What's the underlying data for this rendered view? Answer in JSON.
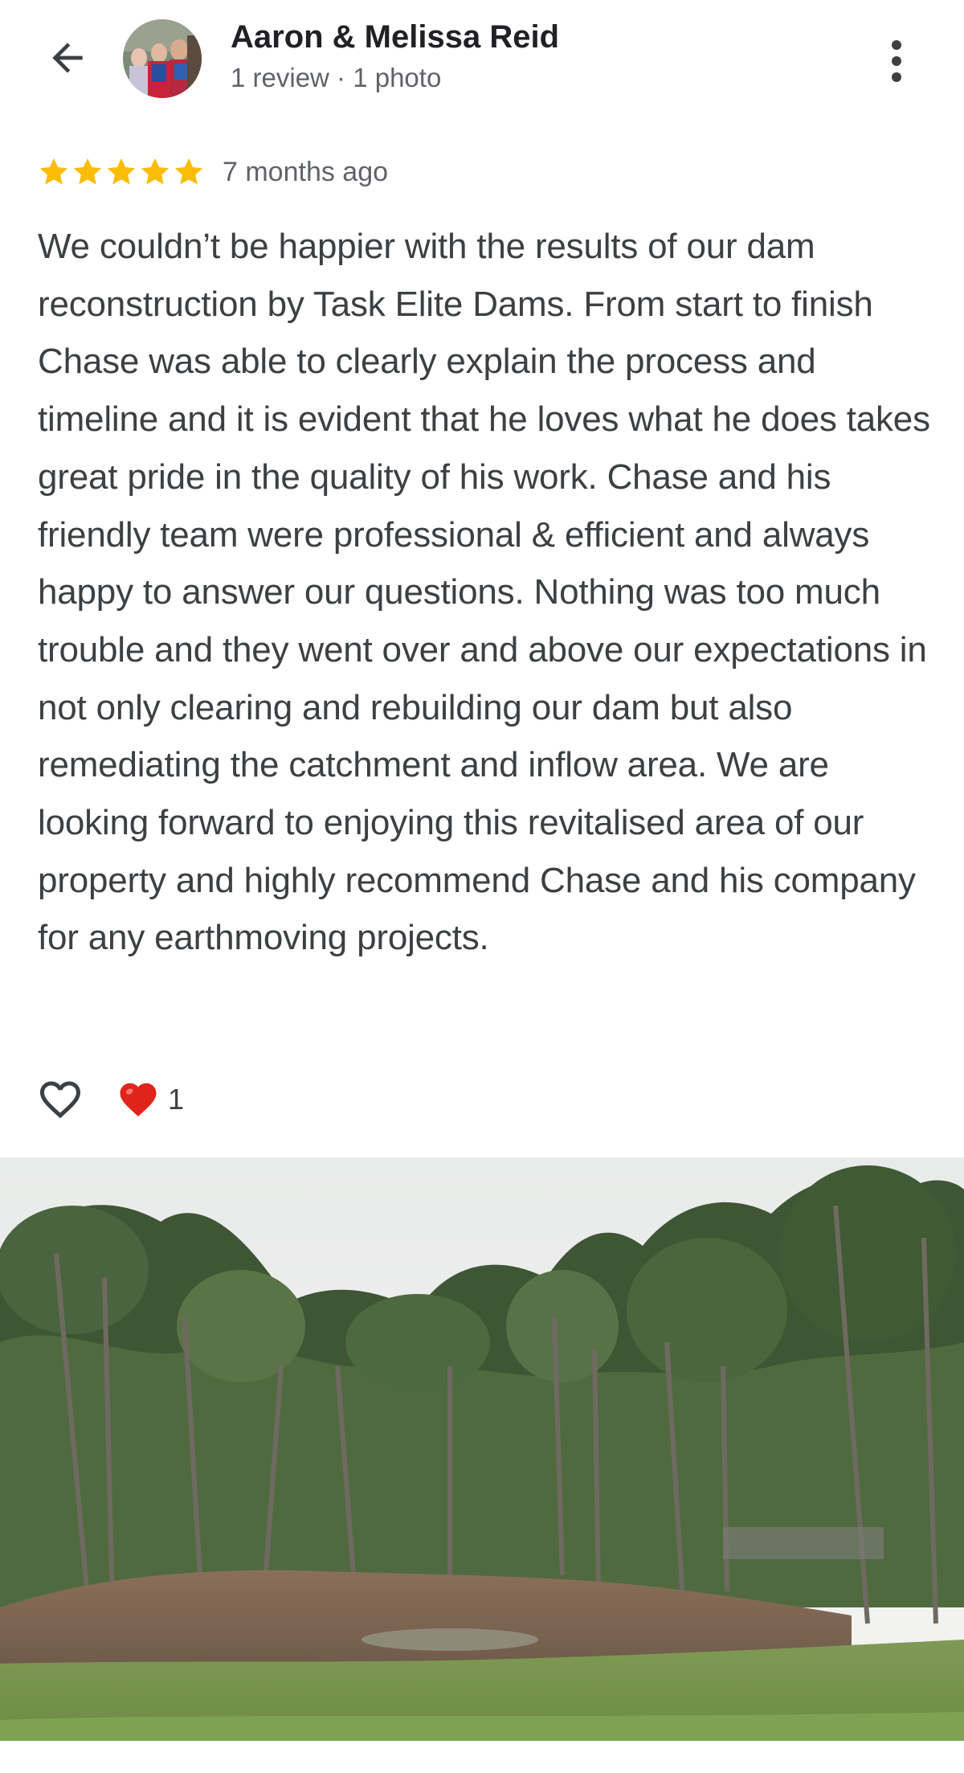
{
  "header": {
    "back_icon": "arrow-left-icon",
    "reviewer_name": "Aaron & Melissa Reid",
    "reviewer_stats": "1 review · 1 photo",
    "more_icon": "more-vertical-icon"
  },
  "review": {
    "rating": 5,
    "rating_max": 5,
    "star_color": "#fbbc04",
    "date": "7 months ago",
    "text": "We couldn’t be happier with the results of our dam reconstruction by Task Elite Dams. From start to finish Chase was able to clearly explain the process and timeline and it is evident that he loves what he does takes great pride in the quality of his work. Chase and his friendly team were professional & efficient and always happy to answer our questions. Nothing was too much trouble and they went over and above our expectations in not only clearing and rebuilding our dam but also remediating the catchment and inflow area. We are looking forward to enjoying this revitalised area of our property and highly recommend Chase and his company for any earthmoving projects."
  },
  "reactions": {
    "like_icon": "heart-outline-icon",
    "reaction_icon": "red-heart-icon",
    "reaction_color": "#e0241b",
    "count": "1"
  },
  "photo": {
    "icon": "dam-landscape-photo"
  }
}
